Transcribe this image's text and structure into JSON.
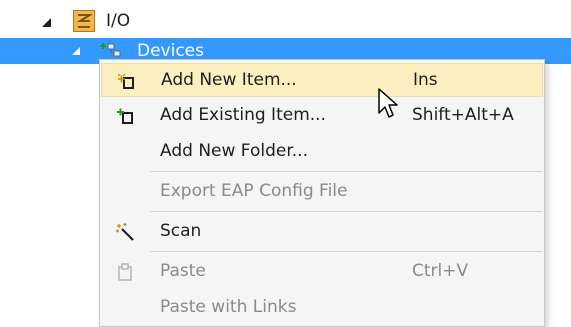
{
  "tree": {
    "io": {
      "label": "I/O",
      "icon": "io-folder-icon"
    },
    "devices": {
      "label": "Devices",
      "icon": "devices-icon"
    }
  },
  "context_menu": {
    "items": [
      {
        "label": "Add New Item...",
        "shortcut": "Ins",
        "icon": "add-new-item-icon",
        "enabled": true,
        "highlighted": true
      },
      {
        "label": "Add Existing Item...",
        "shortcut": "Shift+Alt+A",
        "icon": "add-existing-item-icon",
        "enabled": true
      },
      {
        "label": "Add New Folder...",
        "shortcut": "",
        "enabled": true
      },
      {
        "label": "Export EAP Config File",
        "shortcut": "",
        "enabled": false
      },
      {
        "label": "Scan",
        "shortcut": "",
        "icon": "scan-wand-icon",
        "enabled": true
      },
      {
        "label": "Paste",
        "shortcut": "Ctrl+V",
        "icon": "paste-icon",
        "enabled": false
      },
      {
        "label": "Paste with Links",
        "shortcut": "",
        "enabled": false
      }
    ]
  },
  "colors": {
    "selection": "#3399ff",
    "highlight": "#fcefbf",
    "menu_bg": "#f5f5f5",
    "disabled_text": "#8a8a8a"
  }
}
